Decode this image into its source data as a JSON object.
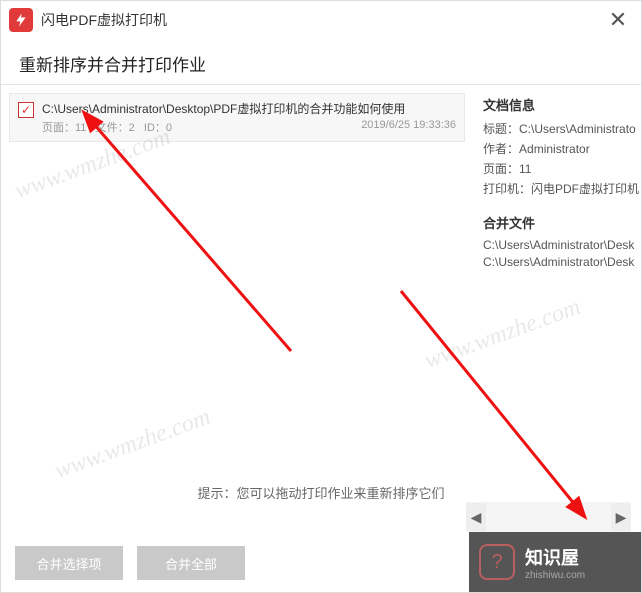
{
  "titlebar": {
    "title": "闪电PDF虚拟打印机"
  },
  "heading": "重新排序并合并打印作业",
  "job": {
    "path": "C:\\Users\\Administrator\\Desktop\\PDF虚拟打印机的合并功能如何使用",
    "pages_label": "页面：11",
    "files_label": "文件：2",
    "id_label": "ID：0",
    "timestamp": "2019/6/25 19:33:36"
  },
  "docinfo": {
    "section_title": "文档信息",
    "title_label": "标题：",
    "title_value": "C:\\Users\\Administrato",
    "author_label": "作者：",
    "author_value": "Administrator",
    "pages_label": "页面：",
    "pages_value": "11",
    "printer_label": "打印机：",
    "printer_value": "闪电PDF虚拟打印机"
  },
  "merge": {
    "section_title": "合并文件",
    "file1": "C:\\Users\\Administrator\\Desk",
    "file2": "C:\\Users\\Administrator\\Desk"
  },
  "hint": "提示：您可以拖动打印作业来重新排序它们",
  "buttons": {
    "merge_selected": "合并选择项",
    "merge_all": "合并全部"
  },
  "brand": {
    "name": "知识屋",
    "domain": "zhishiwu.com"
  },
  "watermark": "www.wmzhe.com"
}
